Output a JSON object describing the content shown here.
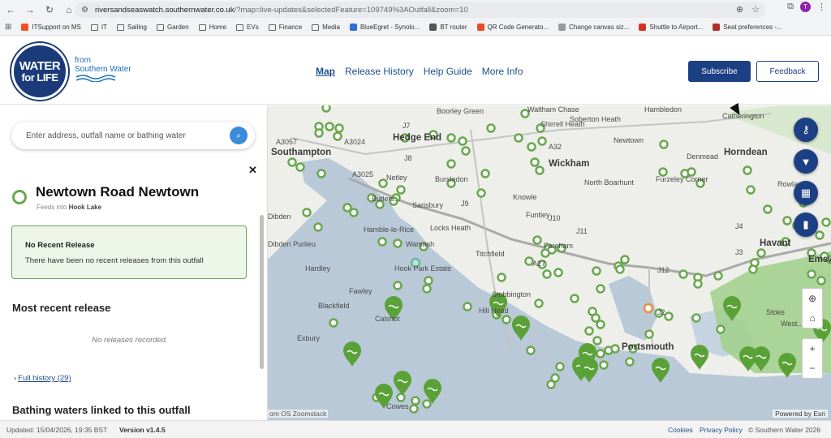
{
  "browser": {
    "url_host": "riversandseaswatch.southernwater.co.uk",
    "url_path": "/?map=live-updates&selectedFeature=109749%3AOutfall&zoom=10",
    "avatar_letter": "T",
    "bookmarks": [
      {
        "label": "ITSupport on MS",
        "icon": "ms-icon",
        "color": "#f25022"
      },
      {
        "label": "IT",
        "icon": "folder-icon"
      },
      {
        "label": "Sailing",
        "icon": "folder-icon"
      },
      {
        "label": "Garden",
        "icon": "folder-icon"
      },
      {
        "label": "Home",
        "icon": "folder-icon"
      },
      {
        "label": "EVs",
        "icon": "folder-icon"
      },
      {
        "label": "Finance",
        "icon": "folder-icon"
      },
      {
        "label": "Media",
        "icon": "folder-icon"
      },
      {
        "label": "BlueEgret - Synolo...",
        "icon": "dsm-icon",
        "color": "#2f6fd6"
      },
      {
        "label": "BT router",
        "icon": "globe-icon",
        "color": "#555555"
      },
      {
        "label": "QR Code Generato...",
        "icon": "qr-icon",
        "color": "#e84a2a"
      },
      {
        "label": "Change canvas siz...",
        "icon": "canvas-icon",
        "color": "#999999"
      },
      {
        "label": "Shuttle to Airport...",
        "icon": "p-icon",
        "color": "#d93025"
      },
      {
        "label": "Seat preferences -...",
        "icon": "seat-icon",
        "color": "#b03030"
      }
    ]
  },
  "header": {
    "logo_line1": "WATER",
    "logo_line2": "for LIFE",
    "logo_from": "from",
    "logo_brand": "Southern Water",
    "nav": [
      "Map",
      "Release History",
      "Help Guide",
      "More Info"
    ],
    "subscribe_label": "Subscribe",
    "feedback_label": "Feedback"
  },
  "panel": {
    "search_placeholder": "Enter address, outfall name or bathing water",
    "outfall_name": "Newtown Road Newtown",
    "feeds_prefix": "Feeds into",
    "feeds_into": "Hook Lake",
    "status_title": "No Recent Release",
    "status_text": "There have been no recent releases from this outfall",
    "recent_heading": "Most recent release",
    "no_releases": "No releases recorded.",
    "full_history": "Full history (29)",
    "bathing_heading": "Bathing waters linked to this outfall"
  },
  "map": {
    "places": [
      {
        "label": "Southampton",
        "big": true
      },
      {
        "label": "Hedge End",
        "big": true
      },
      {
        "label": "Wickham",
        "big": true
      },
      {
        "label": "Horndean",
        "big": true
      },
      {
        "label": "Havant",
        "big": true
      },
      {
        "label": "Emsworth",
        "big": true
      },
      {
        "label": "Portsmouth",
        "big": true
      },
      {
        "label": "Boorley Green"
      },
      {
        "label": "Waltham Chase"
      },
      {
        "label": "Shirrell Heath"
      },
      {
        "label": "Soberton Heath"
      },
      {
        "label": "Hambledon"
      },
      {
        "label": "Catherington"
      },
      {
        "label": "Denmead"
      },
      {
        "label": "Newtown"
      },
      {
        "label": "North Boarhunt"
      },
      {
        "label": "Furzeley Corner"
      },
      {
        "label": "Netley"
      },
      {
        "label": "Bursledon"
      },
      {
        "label": "Knowle"
      },
      {
        "label": "Butlers..."
      },
      {
        "label": "Sarisbury"
      },
      {
        "label": "Funtley"
      },
      {
        "label": "Dibden"
      },
      {
        "label": "Hamble-le-Rice"
      },
      {
        "label": "Locks Heath"
      },
      {
        "label": "Dibden Purlieu"
      },
      {
        "label": "Warsash"
      },
      {
        "label": "Titchfield"
      },
      {
        "label": "Hook Park Estate"
      },
      {
        "label": "Hardley"
      },
      {
        "label": "Fawley"
      },
      {
        "label": "Blackfield"
      },
      {
        "label": "Calshot"
      },
      {
        "label": "Stubbington"
      },
      {
        "label": "Hill Head"
      },
      {
        "label": "Exbury"
      },
      {
        "label": "Cowes"
      },
      {
        "label": "Rowlands..."
      },
      {
        "label": "Stoke"
      },
      {
        "label": "West..."
      },
      {
        "label": "Fareham"
      },
      {
        "label": "J7"
      },
      {
        "label": "J8"
      },
      {
        "label": "J9"
      },
      {
        "label": "J10"
      },
      {
        "label": "J11"
      },
      {
        "label": "J12"
      },
      {
        "label": "J2"
      },
      {
        "label": "J3"
      },
      {
        "label": "J4"
      },
      {
        "label": "A27"
      },
      {
        "label": "A3057"
      },
      {
        "label": "A3024"
      },
      {
        "label": "A3025"
      },
      {
        "label": "A32"
      },
      {
        "label": "A3"
      }
    ],
    "attribution_left": "om OS Zoomstack",
    "attribution_right": "Powered by Esri",
    "controls": [
      "key-icon",
      "filter-icon",
      "map-layers-icon",
      "bookmark-icon"
    ],
    "zoom_in": "+",
    "zoom_out": "−",
    "colors": {
      "land": "#eeeeea",
      "sea": "#b9c9d8",
      "green": "#9fcf8a",
      "marker": "#6aa84f",
      "nav": "#1d3f83"
    }
  },
  "footer": {
    "updated": "Updated: 15/04/2026, 19:35 BST",
    "version": "Version v1.4.5",
    "cookies": "Cookies",
    "privacy": "Privacy Policy",
    "copyright": "© Southern Water 2026"
  }
}
